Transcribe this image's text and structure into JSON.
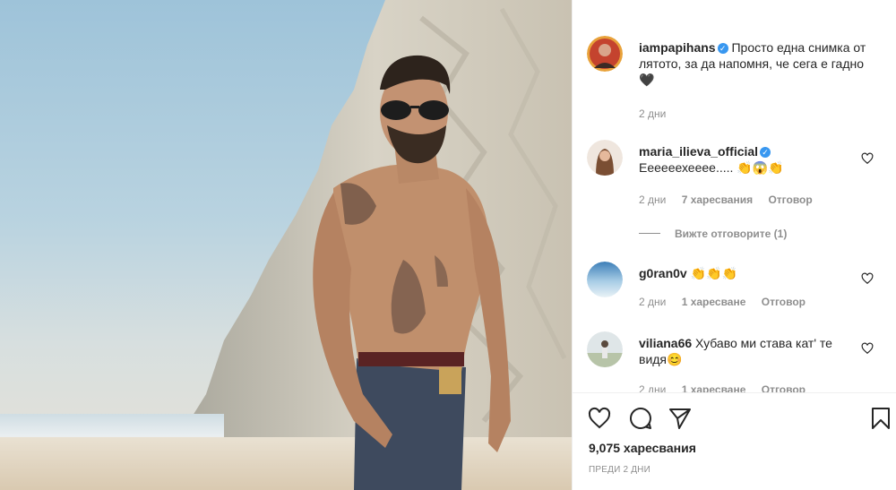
{
  "post": {
    "author": "iampapihans",
    "caption": "Просто една снимка от лятото, за да напомня, че сега е гадно 🖤",
    "age": "2 дни"
  },
  "comments": [
    {
      "username": "maria_ilieva_official",
      "verified": true,
      "text": "Еееееехееее..... 👏😱👏",
      "age": "2 дни",
      "likes": "7 харесвания",
      "reply": "Отговор",
      "view_replies": "Вижте отговорите (1)"
    },
    {
      "username": "g0ran0v",
      "verified": false,
      "text": "👏👏👏",
      "age": "2 дни",
      "likes": "1 харесване",
      "reply": "Отговор"
    },
    {
      "username": "viliana66",
      "verified": false,
      "text": "Хубаво ми става кат' те видя😊",
      "age": "2 дни",
      "likes": "1 харесване",
      "reply": "Отговор"
    }
  ],
  "actions": {
    "likes_count": "9,075 харесвания",
    "posted": "ПРЕДИ 2 ДНИ"
  },
  "icons": {
    "like": "heart-icon",
    "comment": "comment-icon",
    "share": "share-icon",
    "save": "bookmark-icon"
  },
  "colors": {
    "verified_badge": "#3897f0",
    "meta_text": "#8e8e8e"
  }
}
